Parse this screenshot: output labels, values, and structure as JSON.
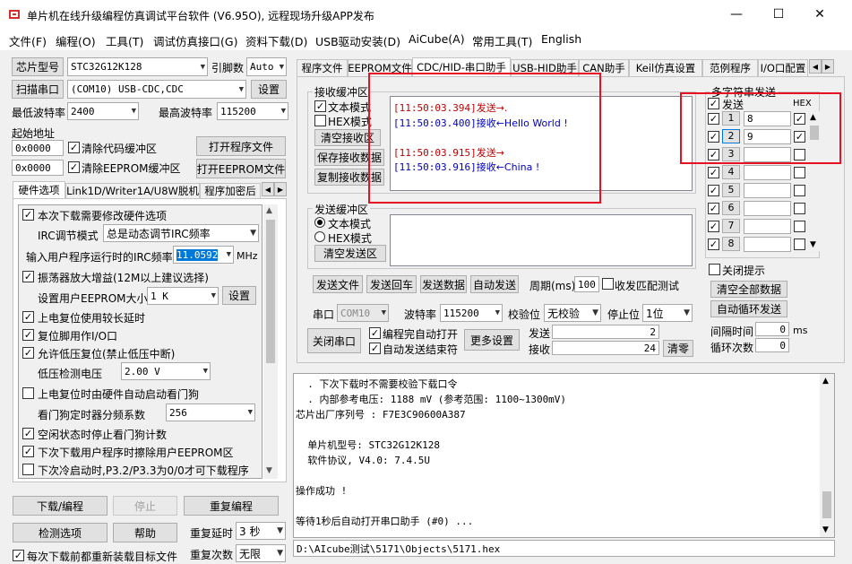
{
  "window": {
    "title": "单片机在线升级编程仿真调试平台软件 (V6.95O), 远程现场升级APP发布",
    "min": "—",
    "max": "☐",
    "close": "✕"
  },
  "menu": [
    "文件(F)",
    "编程(O)",
    "工具(T)",
    "调试仿真接口(G)",
    "资料下载(D)",
    "USB驱动安装(D)",
    "AiCube(A)",
    "常用工具(T)",
    "English"
  ],
  "left": {
    "chip_label": "芯片型号",
    "chip_value": "STC32G12K128",
    "pins_label": "引脚数",
    "pins_value": "Auto",
    "scan_label": "扫描串口",
    "port_value": "(COM10) USB-CDC,CDC",
    "settings_label": "设置",
    "min_baud_label": "最低波特率",
    "min_baud_value": "2400",
    "max_baud_label": "最高波特率",
    "max_baud_value": "115200",
    "start_addr_label": "起始地址",
    "addr1": "0x0000",
    "clear_code_label": "清除代码缓冲区",
    "open_prog_label": "打开程序文件",
    "addr2": "0x0000",
    "clear_eeprom_label": "清除EEPROM缓冲区",
    "open_eeprom_label": "打开EEPROM文件",
    "tabs": [
      "硬件选项",
      "Link1D/Writer1A/U8W脱机",
      "程序加密后"
    ],
    "hw_options": {
      "modify": "本次下载需要修改硬件选项",
      "irc_mode_label": "IRC调节模式",
      "irc_mode_value": "总是动态调节IRC频率",
      "freq_label": "输入用户程序运行时的IRC频率",
      "freq_value": "11.0592",
      "freq_unit": "MHz",
      "osc_gain": "振荡器放大增益(12M以上建议选择)",
      "eeprom_size_label": "设置用户EEPROM大小",
      "eeprom_size_value": "1   K",
      "eeprom_set": "设置",
      "power_delay": "上电复位使用较长延时",
      "reset_io": "复位脚用作I/O口",
      "lvd_reset": "允许低压复位(禁止低压中断)",
      "lvd_voltage_label": "低压检测电压",
      "lvd_voltage_value": "2.00 V",
      "wdt_auto": "上电复位时由硬件自动启动看门狗",
      "wdt_div_label": "看门狗定时器分频系数",
      "wdt_div_value": "256",
      "idle_stop_wdt": "空闲状态时停止看门狗计数",
      "erase_eeprom": "下次下载用户程序时擦除用户EEPROM区",
      "p32p33": "下次冷启动时,P3.2/P3.3为0/0才可下载程序"
    },
    "download_label": "下载/编程",
    "stop_label": "停止",
    "reprogram_label": "重复编程",
    "check_label": "检测选项",
    "help_label": "帮助",
    "repeat_delay_label": "重复延时",
    "repeat_delay_value": "3 秒",
    "repeat_count_label": "重复次数",
    "repeat_count_value": "无限",
    "reload_label": "每次下载前都重新装载目标文件"
  },
  "right_tabs": [
    "程序文件",
    "EEPROM文件",
    "CDC/HID-串口助手",
    "USB-HID助手",
    "CAN助手",
    "Keil仿真设置",
    "范例程序",
    "I/O口配置"
  ],
  "serial": {
    "recv_title": "接收缓冲区",
    "text_mode": "文本模式",
    "hex_mode": "HEX模式",
    "clear_recv": "清空接收区",
    "save_recv": "保存接收数据",
    "copy_recv": "复制接收数据",
    "recv_lines": [
      {
        "time": "[11:50:03.394]",
        "text": "发送→.",
        "color": "#c00000"
      },
      {
        "time": "[11:50:03.400]",
        "text": "接收←Hello World !",
        "color": "#0000c0"
      },
      {
        "time": "",
        "text": "",
        "color": "#000000"
      },
      {
        "time": "[11:50:03.915]",
        "text": "发送→",
        "color": "#c00000"
      },
      {
        "time": "[11:50:03.916]",
        "text": "接收←China !",
        "color": "#0000c0"
      }
    ],
    "send_title": "发送缓冲区",
    "send_text_mode": "文本模式",
    "send_hex_mode": "HEX模式",
    "clear_send": "清空发送区",
    "send_file": "发送文件",
    "send_return": "发送回车",
    "send_data": "发送数据",
    "auto_send": "自动发送",
    "period_label": "周期(ms)",
    "period_value": "100",
    "match_label": "收发匹配测试",
    "port_label": "串口",
    "port_value": "COM10",
    "baud_label": "波特率",
    "baud_value": "115200",
    "parity_label": "校验位",
    "parity_value": "无校验",
    "stop_label": "停止位",
    "stop_value": "1位",
    "close_port": "关闭串口",
    "auto_open": "编程完自动打开",
    "auto_end": "自动发送结束符",
    "more_settings": "更多设置",
    "tx_label": "发送",
    "tx_count": "2",
    "rx_label": "接收",
    "rx_count": "24",
    "clear_count": "清零"
  },
  "multi": {
    "title": "多字符串发送",
    "send_header": "发送",
    "hex_header": "HEX",
    "rows": [
      {
        "n": "1",
        "v": "8",
        "on": true,
        "hex": true
      },
      {
        "n": "2",
        "v": "9",
        "on": true,
        "hex": true
      },
      {
        "n": "3",
        "v": "",
        "on": true,
        "hex": false
      },
      {
        "n": "4",
        "v": "",
        "on": true,
        "hex": false
      },
      {
        "n": "5",
        "v": "",
        "on": true,
        "hex": false
      },
      {
        "n": "6",
        "v": "",
        "on": true,
        "hex": false
      },
      {
        "n": "7",
        "v": "",
        "on": true,
        "hex": false
      },
      {
        "n": "8",
        "v": "",
        "on": true,
        "hex": false
      }
    ],
    "close_hint": "关闭提示",
    "clear_all": "清空全部数据",
    "auto_loop": "自动循环发送",
    "interval_label": "间隔时间",
    "interval_value": "0",
    "interval_unit": "ms",
    "loop_label": "循环次数",
    "loop_value": "0"
  },
  "log": [
    "  . 下次下载时不需要校验下载口令",
    "  . 内部参考电压: 1188 mV (参考范围: 1100~1300mV)",
    "芯片出厂序列号 : F7E3C90600A387",
    "",
    "  单片机型号: STC32G12K128",
    "  软件协议, V4.0: 7.4.5U",
    "",
    "操作成功 !",
    "",
    "等待1秒后自动打开串口助手 (#0) ..."
  ],
  "status_path": "D:\\AIcube测试\\5171\\Objects\\5171.hex"
}
